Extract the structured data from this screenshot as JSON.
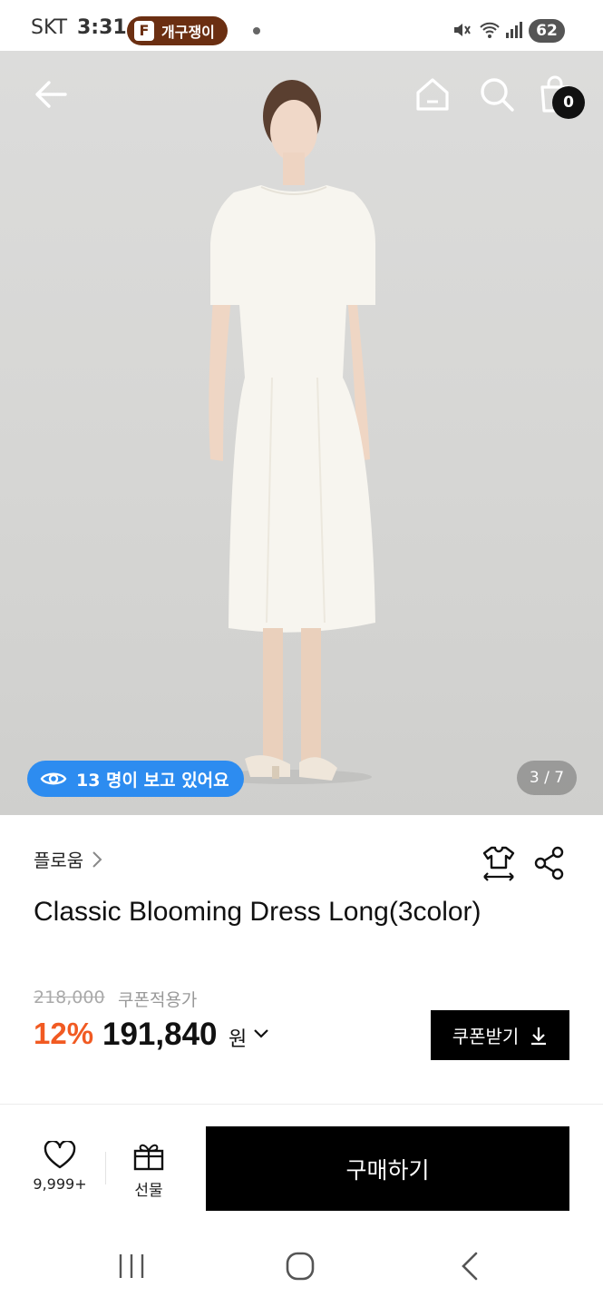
{
  "status_bar": {
    "carrier": "SKT",
    "time": "3:31",
    "app_logo": "F",
    "app_label": "개구쟁이",
    "battery": "62",
    "icons": [
      "mute-icon",
      "wifi-icon",
      "signal-icon"
    ]
  },
  "header": {
    "icons": [
      "back-arrow-icon",
      "home-icon",
      "search-icon",
      "cart-icon"
    ],
    "cart_count": "0"
  },
  "gallery": {
    "viewers_text": "13 명이 보고 있어요",
    "page_counter": "3 / 7"
  },
  "product": {
    "brand": "플로움",
    "title": "Classic Blooming Dress Long(3color)",
    "original_price": "218,000",
    "price_note": "쿠폰적용가",
    "discount": "12%",
    "final_price": "191,840",
    "price_unit": "원",
    "coupon_button": "쿠폰받기"
  },
  "action_bar": {
    "like_count": "9,999+",
    "gift_label": "선물",
    "buy_label": "구매하기"
  },
  "colors": {
    "accent_discount": "#f15a22",
    "viewers_pill": "#2d8cf0",
    "app_chip": "#6b2f12"
  }
}
